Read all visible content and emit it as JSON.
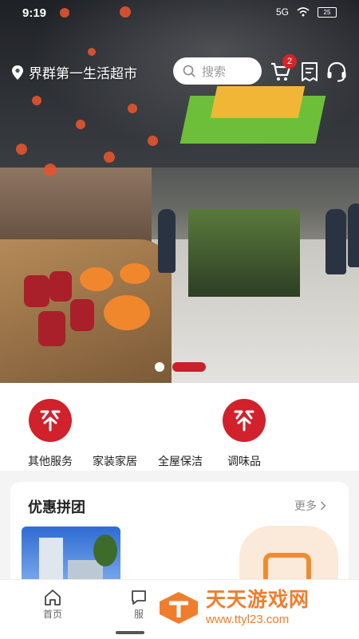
{
  "status_bar": {
    "time": "9:19",
    "network": "5G",
    "battery": "25"
  },
  "header": {
    "store_name": "界群第一生活超市",
    "search_placeholder": "搜索",
    "cart_count": "2"
  },
  "carousel": {
    "slide_count": 2,
    "active_index": 1
  },
  "services": [
    {
      "label": "其他服务",
      "has_logo": true
    },
    {
      "label": "家装家居",
      "has_logo": false
    },
    {
      "label": "全屋保洁",
      "has_logo": false
    },
    {
      "label": "调味品",
      "has_logo": true
    }
  ],
  "group_buy": {
    "title": "优惠拼团",
    "more_label": "更多"
  },
  "tabbar": {
    "items": [
      {
        "label": "首页",
        "icon": "home-icon"
      },
      {
        "label": "服",
        "icon": "message-icon"
      }
    ]
  },
  "watermark": {
    "name": "天天游戏网",
    "url": "www.ttyl23.com"
  },
  "colors": {
    "brand_red": "#d0212c",
    "watermark_orange": "#f07d2c"
  }
}
